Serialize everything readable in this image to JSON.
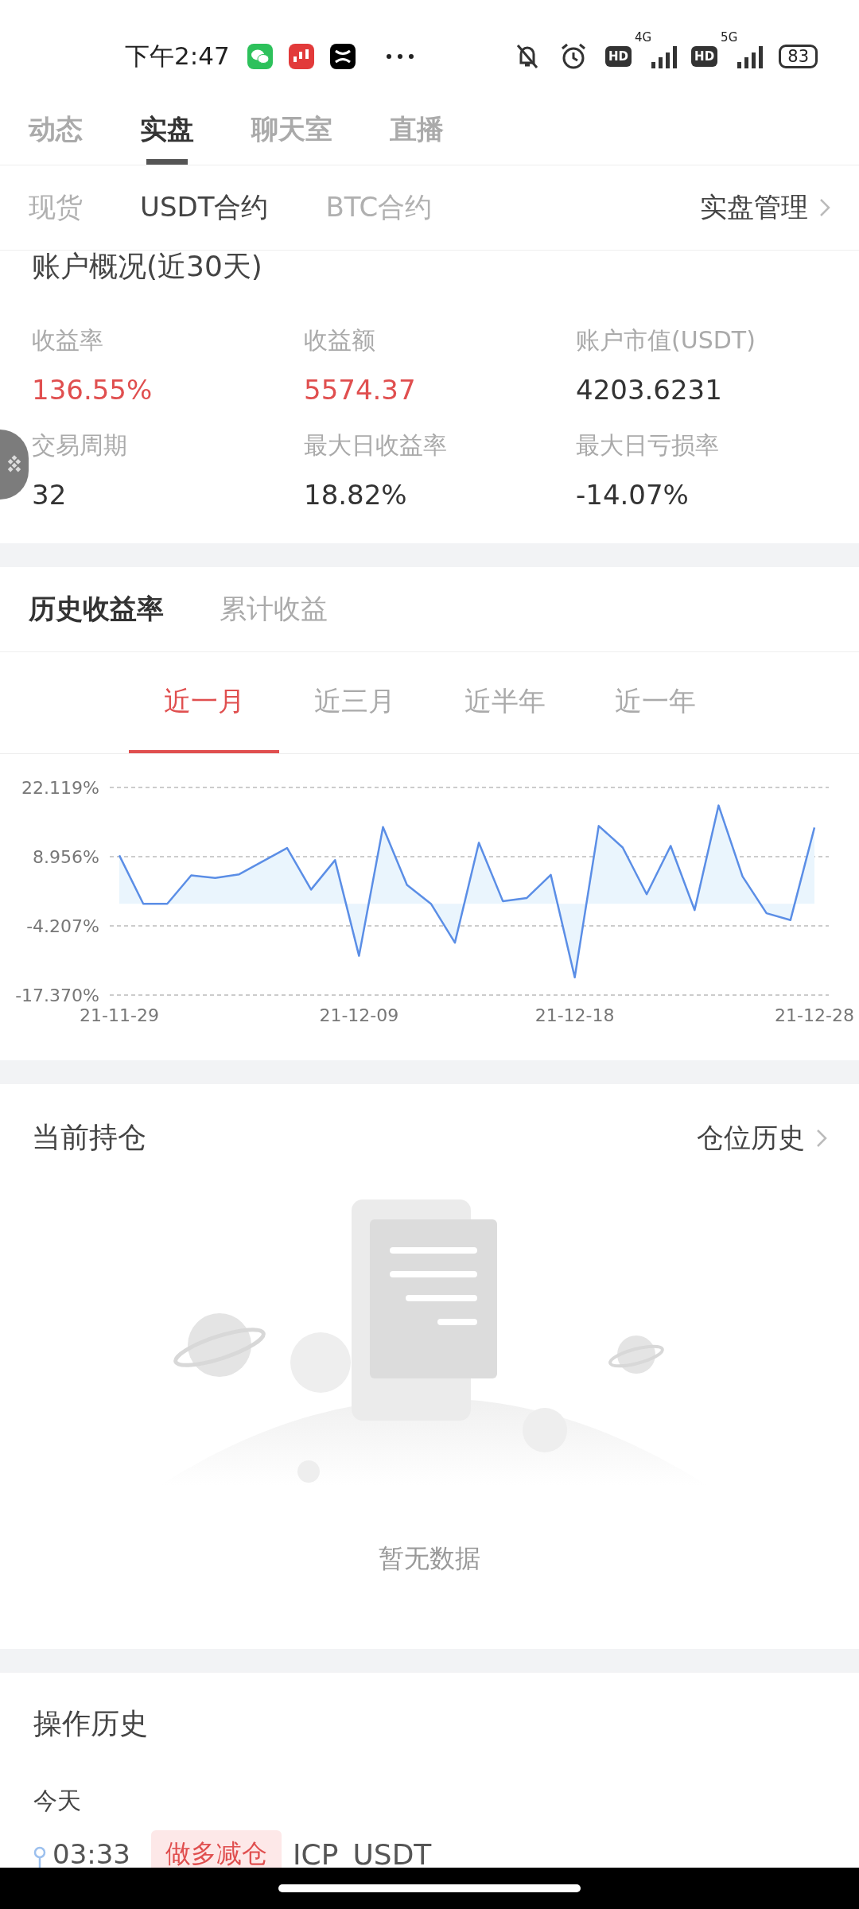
{
  "status_bar": {
    "time": "下午2:47",
    "signals": [
      {
        "hd": "HD",
        "network": "4G"
      },
      {
        "hd": "HD",
        "network": "5G"
      }
    ],
    "battery": "83"
  },
  "top_tabs": [
    {
      "label": "动态",
      "selected": false
    },
    {
      "label": "实盘",
      "selected": true
    },
    {
      "label": "聊天室",
      "selected": false
    },
    {
      "label": "直播",
      "selected": false
    }
  ],
  "sub_tabs": [
    {
      "label": "现货",
      "selected": false
    },
    {
      "label": "USDT合约",
      "selected": true
    },
    {
      "label": "BTC合约",
      "selected": false
    }
  ],
  "manage_link": "实盘管理",
  "overview": {
    "title": "账户概况(近30天)",
    "stats": [
      {
        "label": "收益率",
        "value": "136.55%",
        "color": "#e04f4f"
      },
      {
        "label": "收益额",
        "value": "5574.37",
        "color": "#e04f4f"
      },
      {
        "label": "账户市值(USDT)",
        "value": "4203.6231",
        "color": "#333333"
      },
      {
        "label": "交易周期",
        "value": "32",
        "color": "#333333"
      },
      {
        "label": "最大日收益率",
        "value": "18.82%",
        "color": "#333333"
      },
      {
        "label": "最大日亏损率",
        "value": "-14.07%",
        "color": "#333333"
      }
    ]
  },
  "chart_tabs": [
    {
      "label": "历史收益率",
      "selected": true
    },
    {
      "label": "累计收益",
      "selected": false
    }
  ],
  "period_tabs": [
    {
      "label": "近一月",
      "selected": true
    },
    {
      "label": "近三月",
      "selected": false
    },
    {
      "label": "近半年",
      "selected": false
    },
    {
      "label": "近一年",
      "selected": false
    }
  ],
  "chart_data": {
    "type": "line",
    "categories": [
      "21-11-29",
      null,
      null,
      null,
      null,
      null,
      null,
      null,
      null,
      null,
      "21-12-09",
      null,
      null,
      null,
      null,
      null,
      null,
      null,
      null,
      "21-12-18",
      null,
      null,
      null,
      null,
      null,
      null,
      null,
      null,
      null,
      "21-12-28"
    ],
    "series": [
      {
        "color": "#5b8ee6",
        "values": [
          9.2,
          0,
          0,
          5.4,
          4.9,
          5.6,
          8.1,
          10.6,
          2.7,
          8.3,
          -9.9,
          14.6,
          3.6,
          0,
          -7.4,
          11.6,
          0.5,
          1.1,
          5.5,
          -14.0,
          14.8,
          10.7,
          1.8,
          11.0,
          -1.2,
          18.7,
          5.2,
          -1.8,
          -3.1,
          14.5
        ]
      }
    ],
    "ylim": [
      -17.37,
      22.119
    ],
    "yticks": [
      {
        "value": 22.119,
        "label": "22.119%"
      },
      {
        "value": 8.956,
        "label": "8.956%"
      },
      {
        "value": -4.207,
        "label": "-4.207%"
      },
      {
        "value": -17.37,
        "label": "-17.370%"
      }
    ]
  },
  "positions": {
    "title": "当前持仓",
    "link": "仓位历史",
    "empty_text": "暂无数据"
  },
  "history": {
    "title": "操作历史",
    "groups": [
      {
        "day": "今天",
        "entries": [
          {
            "time": "03:33",
            "action": "做多减仓",
            "symbol": "ICP_USDT"
          }
        ]
      }
    ]
  }
}
